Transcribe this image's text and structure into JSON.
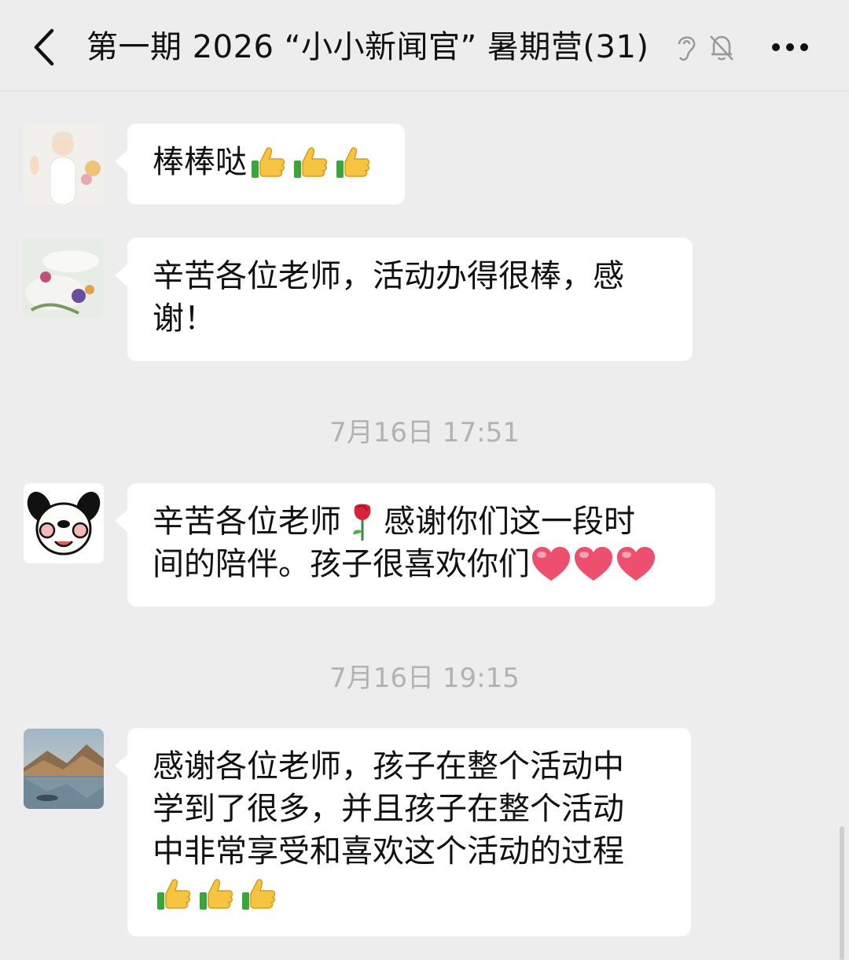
{
  "header": {
    "title": "第一期 2026 “小小新闻官” 暑期营(31)",
    "back_icon": "chevron-left-icon",
    "ear_icon": "ear-icon",
    "mute_icon": "bell-off-icon",
    "more_icon": "more-dots-icon"
  },
  "messages": [
    {
      "lines": [
        "棒棒哒"
      ],
      "emoji": [
        "thumbs-up",
        "thumbs-up",
        "thumbs-up"
      ]
    },
    {
      "lines": [
        "辛苦各位老师，活动办得很棒，感",
        "谢！"
      ]
    },
    {
      "lines": [
        "辛苦各位老师",
        "感谢你们这一段时",
        "间的陪伴。孩子很喜欢你们"
      ],
      "emoji": [
        "rose",
        "heart",
        "heart",
        "heart"
      ]
    },
    {
      "lines": [
        "感谢各位老师，孩子在整个活动中",
        "学到了很多，并且孩子在整个活动",
        "中非常享受和喜欢这个活动的过程"
      ],
      "emoji": [
        "thumbs-up",
        "thumbs-up",
        "thumbs-up"
      ]
    }
  ],
  "timestamps": [
    "7月16日 17:51",
    "7月16日 19:15"
  ],
  "colors": {
    "background": "#ededed",
    "bubble": "#ffffff",
    "timestamp": "#b2b2b2"
  }
}
